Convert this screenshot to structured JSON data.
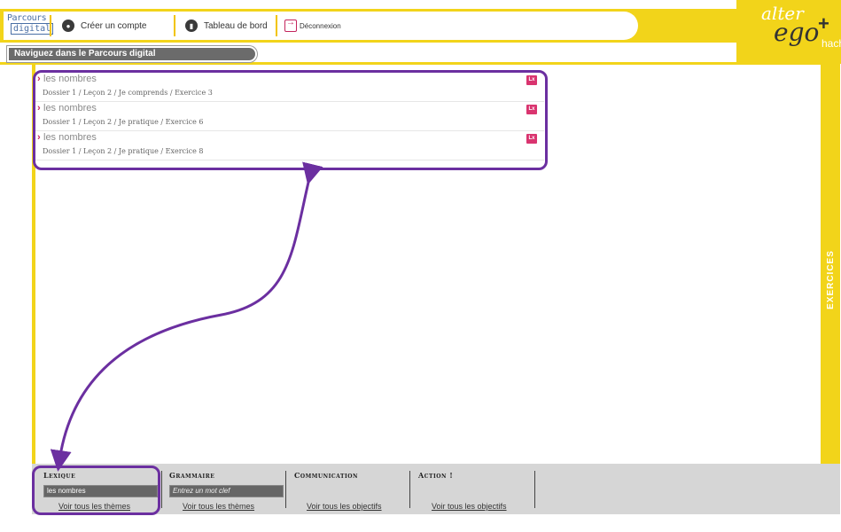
{
  "header": {
    "logo_line1": "Parcours",
    "logo_line2": "digital",
    "create_account": "Créer un compte",
    "dashboard": "Tableau de bord",
    "logout": "Déconnexion",
    "brand_alter": "alter",
    "brand_ego": "ego",
    "brand_plus": "+",
    "brand_hach": "hach"
  },
  "section": {
    "title": "Naviguez dans le Parcours digital",
    "side_label": "EXERCICES"
  },
  "results": [
    {
      "title": "les nombres",
      "path": "Dossier 1 / Leçon 2 / Je comprends / Exercice 3",
      "badge": "Lx"
    },
    {
      "title": "les nombres",
      "path": "Dossier 1 / Leçon 2 / Je pratique / Exercice 6",
      "badge": "Lx"
    },
    {
      "title": "les nombres",
      "path": "Dossier 1 / Leçon 2 / Je pratique / Exercice 8",
      "badge": "Lx"
    }
  ],
  "filters": [
    {
      "title": "Lexique",
      "input_value": "les nombres",
      "link": "Voir tous les thèmes"
    },
    {
      "title": "Grammaire",
      "input_placeholder": "Entrez un mot clef",
      "link": "Voir tous les thèmes"
    },
    {
      "title": "Communication",
      "link": "Voir tous les objectifs"
    },
    {
      "title": "Action !",
      "link": "Voir tous les objectifs"
    }
  ],
  "colors": {
    "accent_yellow": "#f2d41a",
    "annotation_purple": "#6b2fa0",
    "badge_pink": "#d9346f",
    "arrow_pink": "#c3245c"
  }
}
